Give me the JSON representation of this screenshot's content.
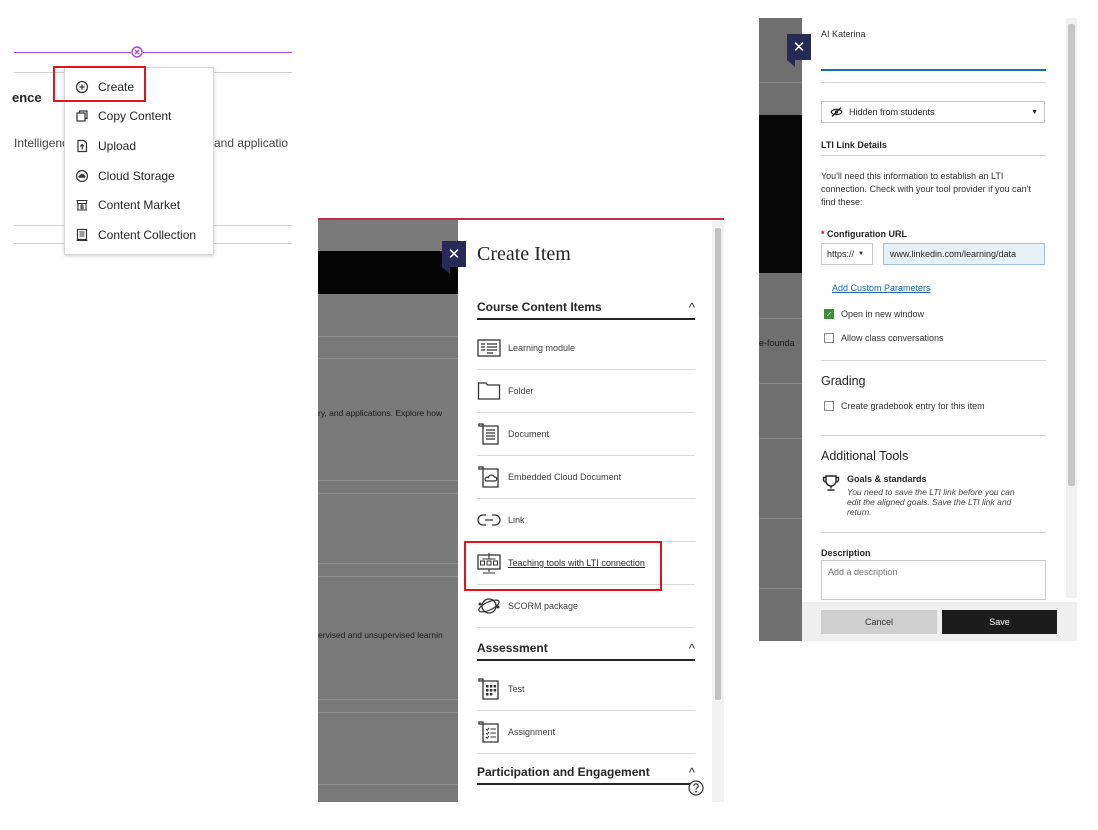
{
  "panel1": {
    "heading_fragment": "ence",
    "desc_left": "Intelligenc",
    "desc_right": "and applicatio",
    "menu": [
      {
        "label": "Create",
        "icon": "plus-circle-icon"
      },
      {
        "label": "Copy Content",
        "icon": "copy-icon"
      },
      {
        "label": "Upload",
        "icon": "upload-icon"
      },
      {
        "label": "Cloud Storage",
        "icon": "cloud-icon"
      },
      {
        "label": "Content Market",
        "icon": "market-icon"
      },
      {
        "label": "Content Collection",
        "icon": "collection-icon"
      }
    ],
    "highlight_color": "#e0141e",
    "divider_color": "#a64ac9"
  },
  "panel2": {
    "title": "Create Item",
    "bg_text_1": "ry, and applications. Explore how",
    "bg_text_2": "ervised and unsupervised learnin",
    "sections": [
      {
        "label": "Course Content Items",
        "items": [
          {
            "label": "Learning module",
            "icon": "learning-module-icon"
          },
          {
            "label": "Folder",
            "icon": "folder-icon"
          },
          {
            "label": "Document",
            "icon": "document-icon"
          },
          {
            "label": "Embedded Cloud Document",
            "icon": "cloud-document-icon"
          },
          {
            "label": "Link",
            "icon": "link-icon"
          },
          {
            "label": "Teaching tools with LTI connection",
            "icon": "lti-tools-icon"
          },
          {
            "label": "SCORM package",
            "icon": "scorm-icon"
          }
        ]
      },
      {
        "label": "Assessment",
        "items": [
          {
            "label": "Test",
            "icon": "test-icon"
          },
          {
            "label": "Assignment",
            "icon": "assignment-icon"
          }
        ]
      },
      {
        "label": "Participation and Engagement",
        "items": []
      }
    ],
    "close_icon": "close-icon",
    "accent": "#262a55"
  },
  "panel3": {
    "bg_text": "e-founda",
    "name_value": "AI Katerina",
    "visibility": "Hidden from students",
    "lti_section": "LTI Link Details",
    "lti_info": "You'll need this information to establish an LTI connection. Check with your tool provider if you can't find these:",
    "config_label_req": "*",
    "config_label": "Configuration URL",
    "scheme": "https://",
    "url_value": "www.linkedin.com/learning/data",
    "add_params": "Add Custom Parameters",
    "open_new_window": "Open in new window",
    "open_new_window_checked": true,
    "allow_conversations": "Allow class conversations",
    "allow_conversations_checked": false,
    "grading_heading": "Grading",
    "gradebook_entry": "Create gradebook entry for this item",
    "additional_heading": "Additional Tools",
    "goals_title": "Goals & standards",
    "goals_desc": "You need to save the LTI link before you can edit the aligned goals. Save the LTI link and return.",
    "description_label": "Description",
    "description_placeholder": "Add a description",
    "cancel": "Cancel",
    "save": "Save"
  }
}
